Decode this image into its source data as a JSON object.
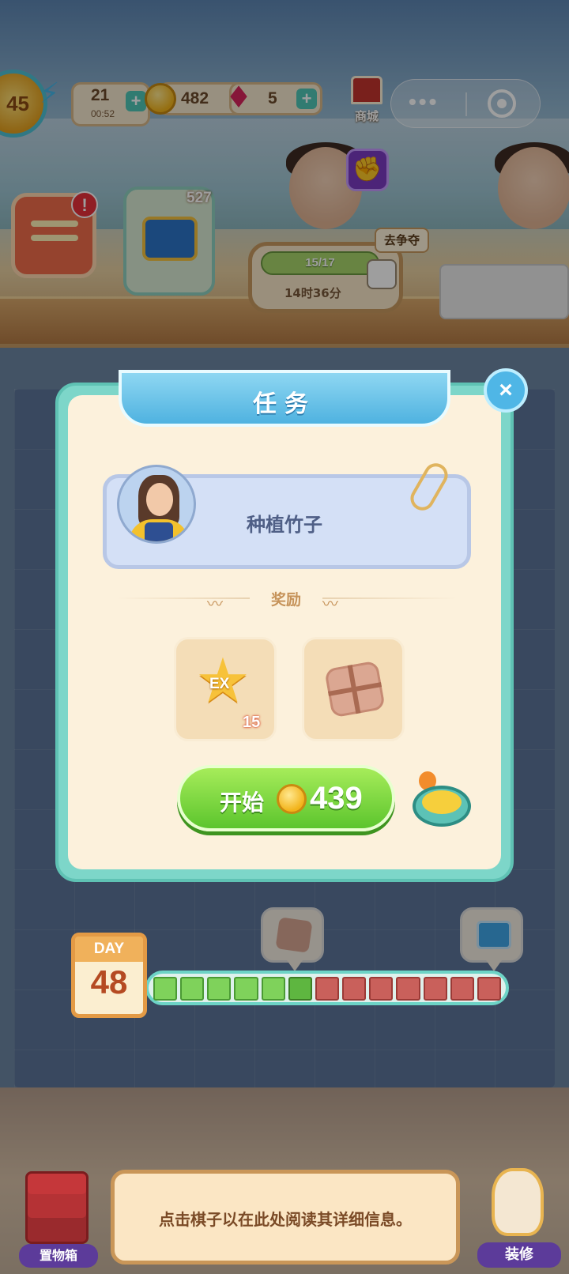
{
  "hud": {
    "level": "45",
    "energy": {
      "value": "21",
      "timer": "00:52",
      "plus": "+"
    },
    "coins": {
      "value": "482"
    },
    "gems": {
      "value": "5",
      "plus": "+"
    },
    "shop_label": "商城",
    "capsule_dots": "•••"
  },
  "scene": {
    "task_alert": "!",
    "chest_count": "527",
    "event_progress": "15/17",
    "event_timer": "14时36分",
    "compete_label": "去争夺"
  },
  "dialog": {
    "title": "任务",
    "close": "×",
    "task_name": "种植竹子",
    "reward_label": "奖励",
    "rewards": [
      {
        "icon": "ex-star-icon",
        "label": "EX",
        "count": "15"
      },
      {
        "icon": "parcel-icon"
      }
    ],
    "start_label": "开始",
    "start_price": "439"
  },
  "board": {
    "day_label": "DAY",
    "day_number": "48",
    "day_progress": {
      "done": 5,
      "current": 1,
      "todo": 7
    }
  },
  "bottom": {
    "storage_label": "置物箱",
    "info_text": "点击棋子以在此处阅读其详细信息。",
    "decorate_label": "装修"
  },
  "colors": {
    "dialog_border": "#7dd6c9",
    "title_ribbon": "#4fb2e0",
    "start_button": "#5cc52d",
    "progress_done": "#7fd25b",
    "progress_todo": "#c9605b"
  }
}
